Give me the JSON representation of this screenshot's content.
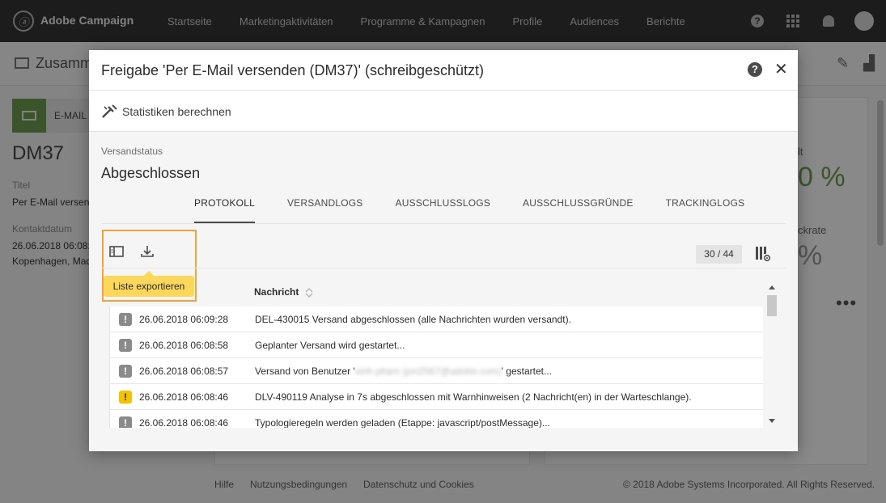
{
  "app": {
    "brand": "Adobe Campaign",
    "nav": [
      "Startseite",
      "Marketingaktivitäten",
      "Programme & Kampagnen",
      "Profile",
      "Audiences",
      "Berichte"
    ]
  },
  "background": {
    "page_title": "Zusamm",
    "channel_label": "E-MAIL",
    "code": "DM37",
    "title_label": "Titel",
    "title_value": "Per E-Mail versend",
    "contact_label": "Kontaktdatum",
    "contact_date": "26.06.2018 06:08:5",
    "contact_place": "Kopenhagen, Mad",
    "stat1_label": "lt",
    "stat1_value": "0 %",
    "stat2_label": "ckrate",
    "stat2_value": "%",
    "footer_links": [
      "Hilfe",
      "Nutzungsbedingungen",
      "Datenschutz und Cookies"
    ],
    "copyright": "© 2018 Adobe Systems Incorporated. All Rights Reserved."
  },
  "modal": {
    "title": "Freigabe 'Per E-Mail versenden (DM37)' (schreibgeschützt)",
    "toolbar_action": "Statistiken berechnen",
    "status_label": "Versandstatus",
    "status_value": "Abgeschlossen",
    "tabs": [
      "PROTOKOLL",
      "VERSANDLOGS",
      "AUSSCHLUSSLOGS",
      "AUSSCHLUSSGRÜNDE",
      "TRACKINGLOGS"
    ],
    "active_tab": "PROTOKOLL",
    "tooltip": "Liste exportieren",
    "counter": "30 / 44",
    "column_header": "Nachricht",
    "rows": [
      {
        "level": "info",
        "date": "26.06.2018 06:09:28",
        "message": "DEL-430015 Versand abgeschlossen (alle Nachrichten wurden versandt)."
      },
      {
        "level": "info",
        "date": "26.06.2018 06:08:58",
        "message": "Geplanter Versand wird gestartet..."
      },
      {
        "level": "info",
        "date": "26.06.2018 06:08:57",
        "message_pre": "Versand von Benutzer '",
        "message_blurred": "vinh pham (jon2567@adobe.com)",
        "message_post": "' gestartet..."
      },
      {
        "level": "warning",
        "date": "26.06.2018 06:08:46",
        "message": "DLV-490119 Analyse in 7s abgeschlossen mit Warnhinweisen (2 Nachricht(en) in der Warteschlange)."
      },
      {
        "level": "info",
        "date": "26.06.2018 06:08:46",
        "message": "Typologieregeln werden geladen (Etappe: javascript/postMessage)..."
      }
    ]
  },
  "colors": {
    "topbar": "#343434",
    "accent_green": "#6e9a50",
    "highlight_border": "#f3a23e",
    "tooltip_bg": "#fbd75c",
    "warning_icon": "#f5c200",
    "info_icon": "#8a8a8a"
  }
}
